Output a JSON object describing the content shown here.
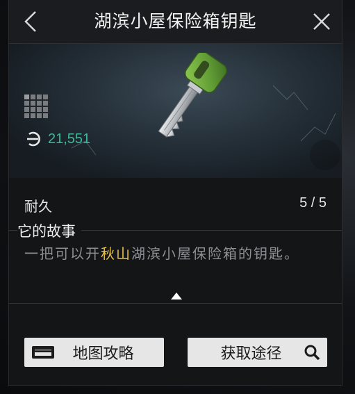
{
  "header": {
    "title": "湖滨小屋保险箱钥匙",
    "back_icon": "chevron-left-icon",
    "close_icon": "close-icon"
  },
  "item": {
    "price": "21,551",
    "price_color": "#3fb89a",
    "currency_icon": "currency-icon",
    "size_icon": "grid-size-icon",
    "key_color": "#6fae3e"
  },
  "stats": {
    "durability_label": "耐久",
    "durability_value": "5 / 5"
  },
  "story": {
    "title": "它的故事",
    "text_before": "一把可以开",
    "highlight": "秋山",
    "text_after": "湖滨小屋保险箱的钥匙。",
    "highlight_color": "#e7c34a"
  },
  "actions": {
    "map_label": "地图攻略",
    "source_label": "获取途径",
    "map_icon": "map-book-icon",
    "source_icon": "search-icon"
  }
}
